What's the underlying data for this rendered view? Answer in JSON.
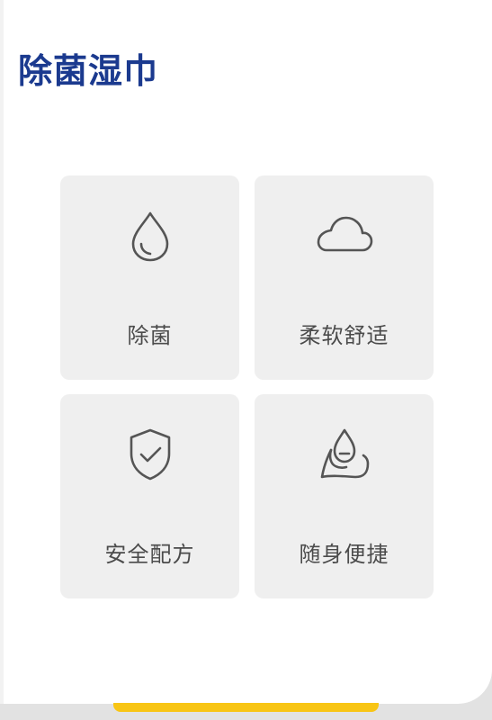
{
  "header": {
    "title": "除菌湿巾"
  },
  "features": [
    {
      "label": "除菌",
      "icon": "water-drop-icon"
    },
    {
      "label": "柔软舒适",
      "icon": "cloud-icon"
    },
    {
      "label": "安全配方",
      "icon": "shield-check-icon"
    },
    {
      "label": "随身便捷",
      "icon": "hand-water-drop-icon"
    }
  ],
  "colors": {
    "title": "#1b3a8f",
    "tile_background": "#efefef",
    "label_text": "#4b4b4b",
    "icon_stroke": "#555555",
    "accent_yellow": "#f8c515"
  }
}
